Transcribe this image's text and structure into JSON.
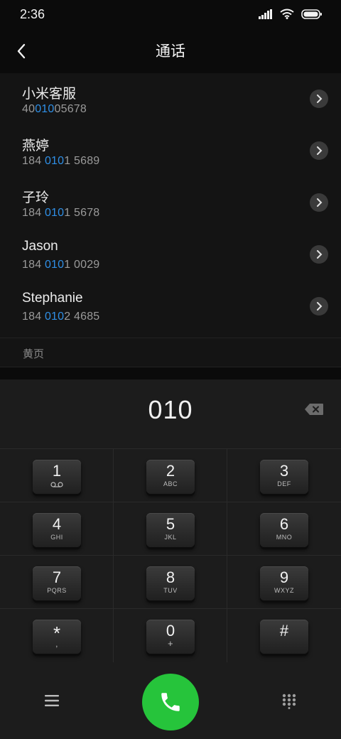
{
  "status_bar": {
    "time": "2:36",
    "icons": [
      "signal-icon",
      "wifi-icon",
      "battery-icon"
    ]
  },
  "header": {
    "title": "通话",
    "back_icon": "back-arrow-icon"
  },
  "contacts": [
    {
      "name": "小米客服",
      "number_pre": "40",
      "number_match": "010",
      "number_post": "05678"
    },
    {
      "name": "燕婷",
      "number_pre": "184 ",
      "number_match": "010",
      "number_post": "1 5689"
    },
    {
      "name": "子玲",
      "number_pre": "184 ",
      "number_match": "010",
      "number_post": "1 5678"
    },
    {
      "name": "Jason",
      "number_pre": "184 ",
      "number_match": "010",
      "number_post": "1 0029"
    },
    {
      "name": "Stephanie",
      "number_pre": "184 ",
      "number_match": "010",
      "number_post": "2 4685"
    }
  ],
  "yellow_pages": {
    "label": "黄页"
  },
  "dial": {
    "digits": "010"
  },
  "keypad": [
    {
      "digit": "1",
      "letters": ""
    },
    {
      "digit": "2",
      "letters": "ABC"
    },
    {
      "digit": "3",
      "letters": "DEF"
    },
    {
      "digit": "4",
      "letters": "GHI"
    },
    {
      "digit": "5",
      "letters": "JKL"
    },
    {
      "digit": "6",
      "letters": "MNO"
    },
    {
      "digit": "7",
      "letters": "PQRS"
    },
    {
      "digit": "8",
      "letters": "TUV"
    },
    {
      "digit": "9",
      "letters": "WXYZ"
    },
    {
      "digit": "*",
      "letters": ","
    },
    {
      "digit": "0",
      "letters": "+"
    },
    {
      "digit": "#",
      "letters": ""
    }
  ],
  "colors": {
    "accent_blue": "#2f8fe6",
    "call_green": "#26c43b",
    "background": "#1c1c1c"
  }
}
